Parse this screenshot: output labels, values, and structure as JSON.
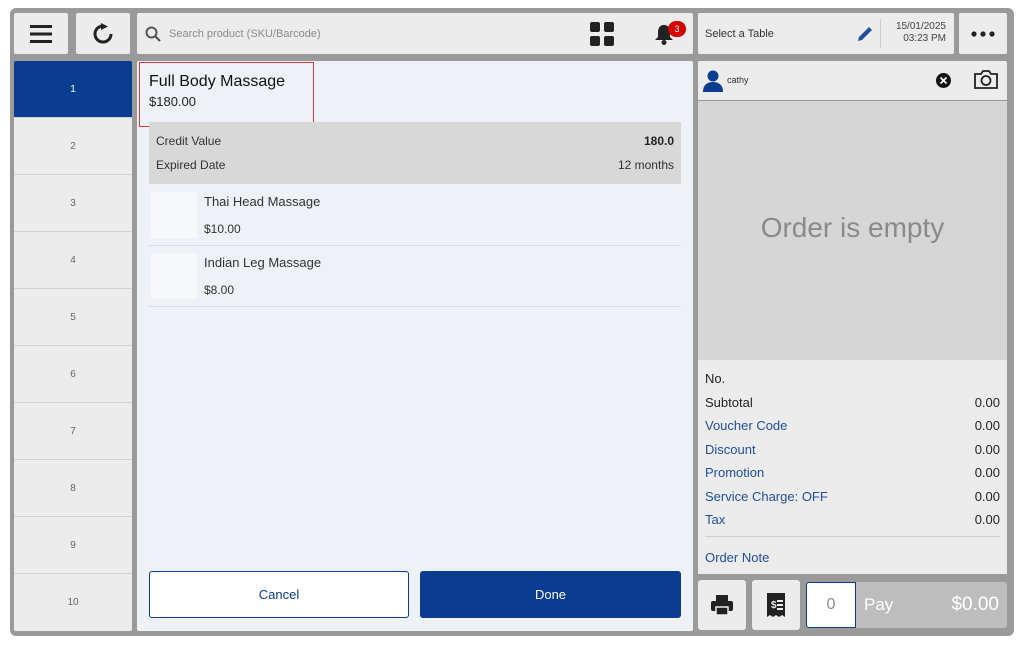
{
  "topbar": {
    "search_placeholder": "Search product (SKU/Barcode)",
    "notification_count": "3",
    "table_label": "Select a Table",
    "date": "15/01/2025",
    "time": "03:23 PM"
  },
  "left_list": {
    "items": [
      "1",
      "2",
      "3",
      "4",
      "5",
      "6",
      "7",
      "8",
      "9",
      "10"
    ],
    "active_index": 0
  },
  "product": {
    "title": "Full Body Massage",
    "price": "$180.00",
    "credit_value_label": "Credit Value",
    "credit_value": "180.0",
    "expired_label": "Expired Date",
    "expired_value": "12 months",
    "items": [
      {
        "name": "Thai Head Massage",
        "price": "$10.00"
      },
      {
        "name": "Indian Leg Massage",
        "price": "$8.00"
      }
    ],
    "cancel_label": "Cancel",
    "done_label": "Done"
  },
  "order": {
    "customer_name": "cathy",
    "empty_text": "Order is empty",
    "no_label": "No.",
    "rows": [
      {
        "label": "Subtotal",
        "value": "0.00"
      },
      {
        "label": "Voucher Code",
        "value": "0.00"
      },
      {
        "label": "Discount",
        "value": "0.00"
      },
      {
        "label": "Promotion",
        "value": "0.00"
      },
      {
        "label": "Service Charge: OFF",
        "value": "0.00"
      },
      {
        "label": "Tax",
        "value": "0.00"
      }
    ],
    "note_label": "Order Note",
    "qty": "0",
    "pay_label": "Pay",
    "pay_amount": "$0.00"
  },
  "colors": {
    "primary": "#0a3c8f",
    "link": "#1f4f9e",
    "badge": "#d50000",
    "highlight_border": "#e0383e"
  }
}
